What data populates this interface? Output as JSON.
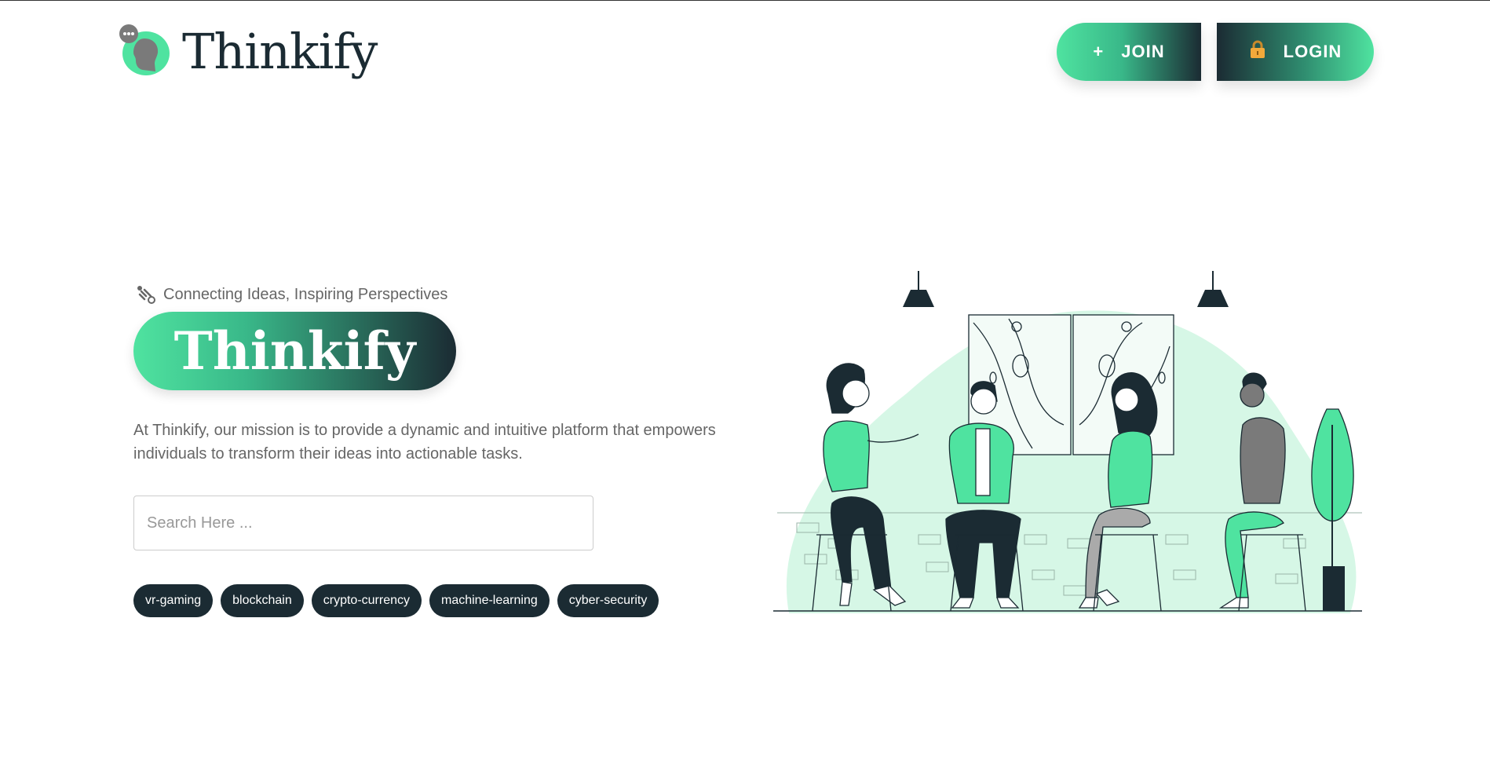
{
  "header": {
    "logo_text": "Thinkify",
    "join_label": "JOIN",
    "login_label": "LOGIN",
    "join_icon": "plus-icon",
    "login_icon": "lock-icon"
  },
  "hero": {
    "tagline": "Connecting Ideas, Inspiring Perspectives",
    "title": "Thinkify",
    "mission": "At Thinkify, our mission is to provide a dynamic and intuitive platform that empowers individuals to transform their ideas into actionable tasks."
  },
  "search": {
    "placeholder": "Search Here ...",
    "value": ""
  },
  "tags": [
    "vr-gaming",
    "blockchain",
    "crypto-currency",
    "machine-learning",
    "cyber-security"
  ],
  "colors": {
    "accent": "#4fe3a0",
    "dark": "#1b2b33",
    "text_muted": "#666666",
    "illustration_bg": "#d6f7e6"
  }
}
